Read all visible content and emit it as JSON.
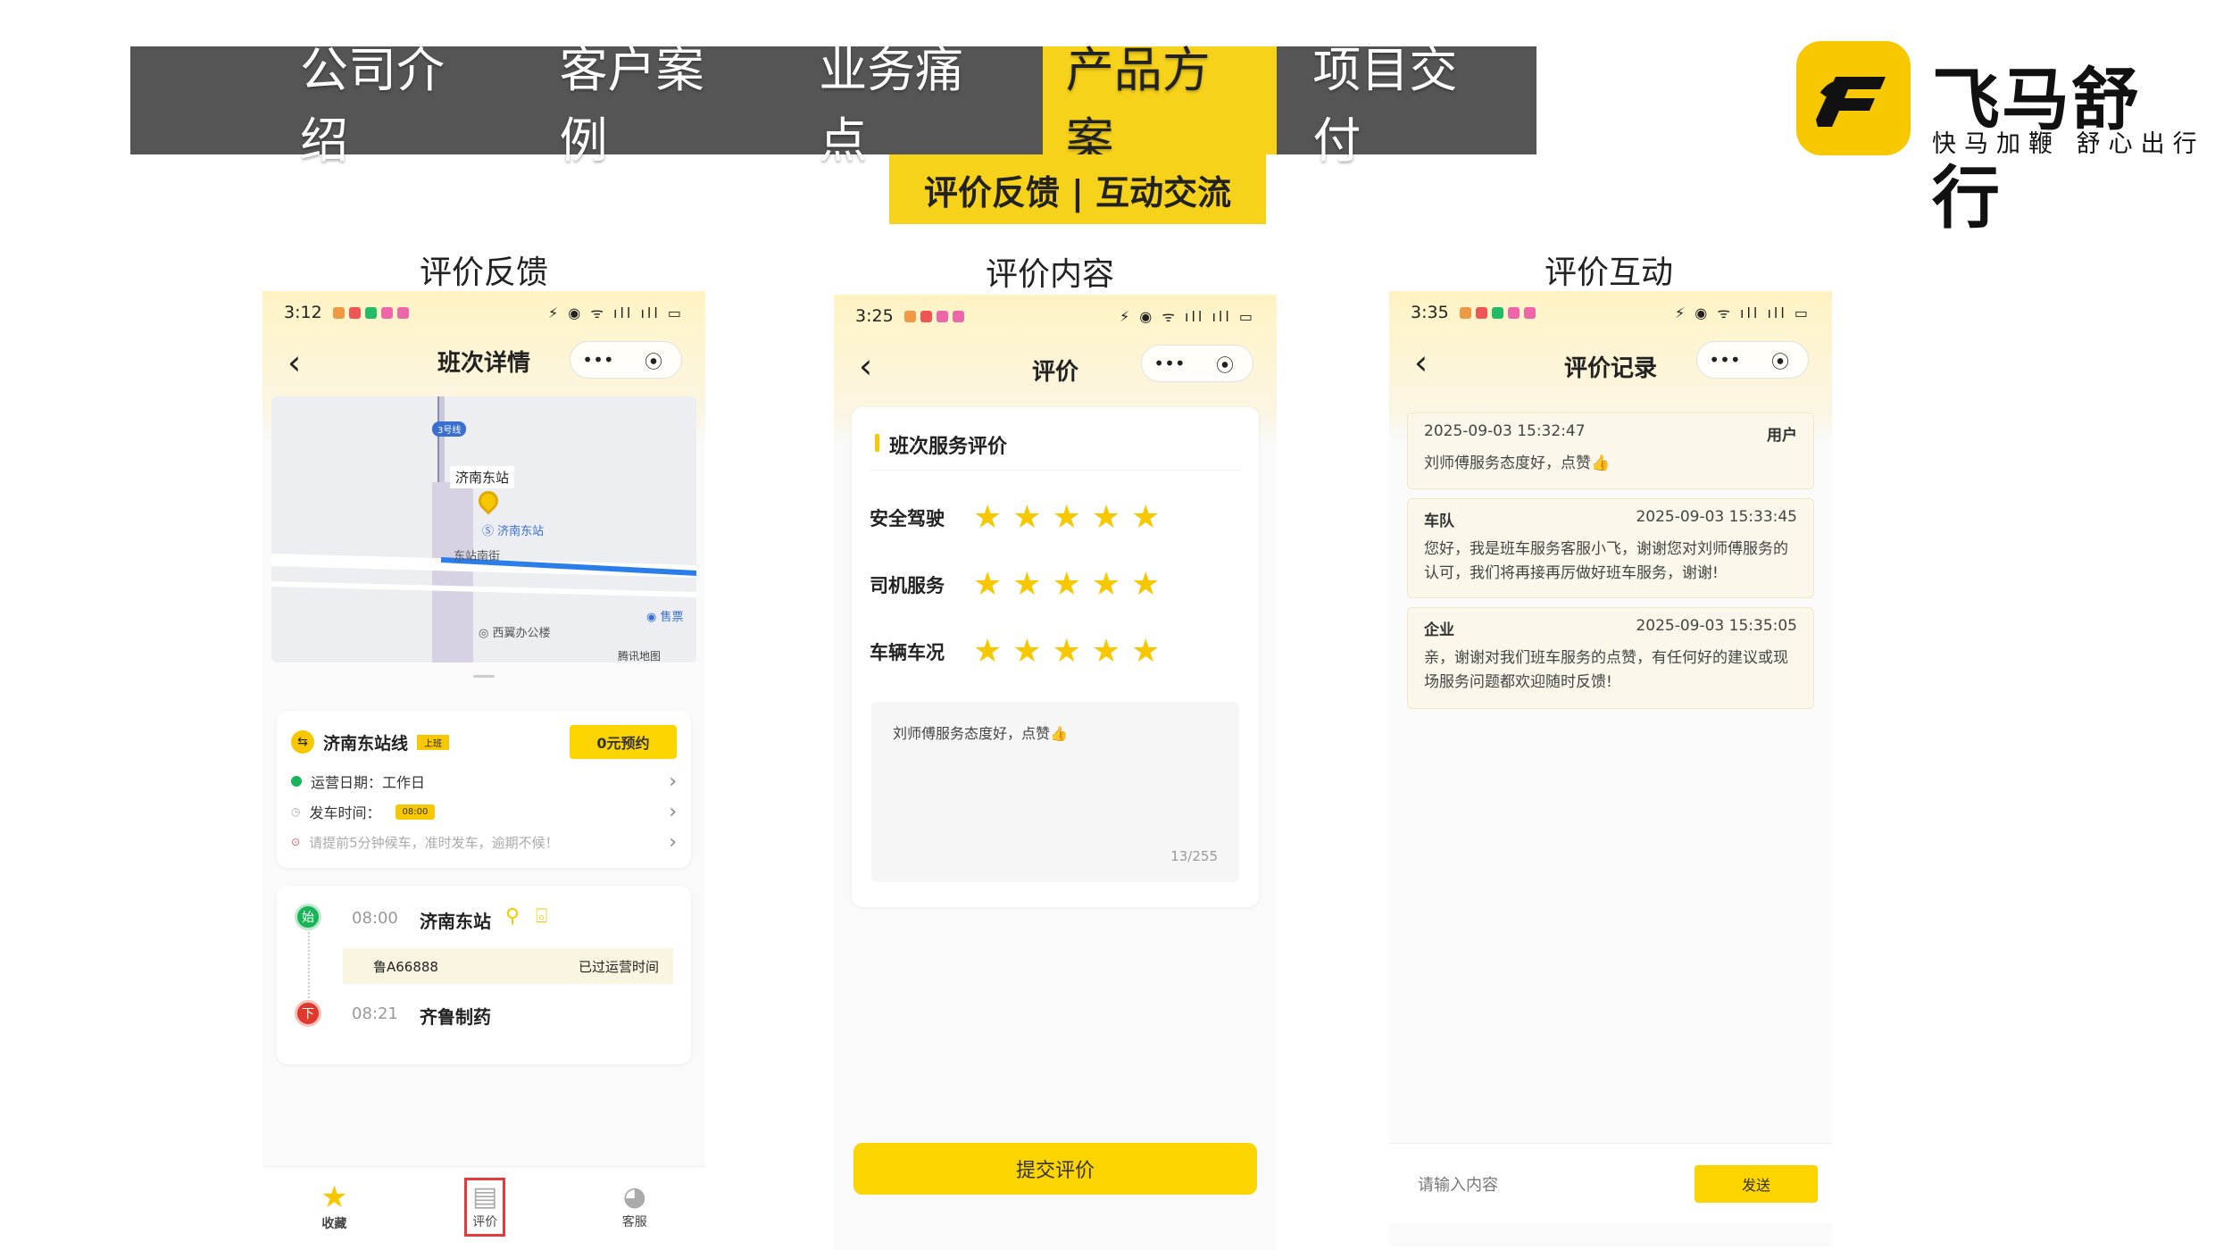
{
  "nav": {
    "tabs": [
      "公司介绍",
      "客户案例",
      "业务痛点",
      "产品方案",
      "项目交付"
    ],
    "active": 3,
    "subtab": "评价反馈 | 互动交流"
  },
  "logo": {
    "name": "飞马舒行",
    "slogan": "快马加鞭  舒心出行"
  },
  "colors": {
    "accent": "#f7d21a",
    "nav_bg": "#555555",
    "star": "#f7c800",
    "start_green": "#19b35a",
    "end_red": "#e0382c"
  },
  "phone1": {
    "caption": "评价反馈",
    "status_time": "3:12",
    "title": "班次详情",
    "map": {
      "line_badge": "3号线",
      "station_label": "济南东站",
      "poi_station": "济南东站",
      "street": "东站南街",
      "poi_office": "西翼办公楼",
      "poi_ticket": "售票",
      "map_brand": "腾讯地图"
    },
    "route_name": "济南东站线",
    "route_tag": "上班",
    "reserve_button": "0元预约",
    "operating_date": "运营日期：工作日",
    "depart_label": "发车时间：",
    "depart_time": "08:00",
    "notice": "请提前5分钟候车，准时发车，逾期不候！",
    "start_badge": "始",
    "start_time": "08:00",
    "start_station": "济南东站",
    "plate": "鲁A66888",
    "plate_status": "已过运营时间",
    "end_badge": "下",
    "end_time": "08:21",
    "end_station": "齐鲁制药",
    "tabs": [
      "收藏",
      "评价",
      "客服"
    ]
  },
  "phone2": {
    "caption": "评价内容",
    "status_time": "3:25",
    "title": "评价",
    "section": "班次服务评价",
    "ratings": [
      {
        "label": "安全驾驶",
        "stars": 5
      },
      {
        "label": "司机服务",
        "stars": 5
      },
      {
        "label": "车辆车况",
        "stars": 5
      }
    ],
    "comment": "刘师傅服务态度好，点赞👍",
    "counter": "13/255",
    "submit": "提交评价"
  },
  "phone3": {
    "caption": "评价互动",
    "status_time": "3:35",
    "title": "评价记录",
    "messages": [
      {
        "who": "用户",
        "time": "2025-09-03 15:32:47",
        "text": "刘师傅服务态度好，点赞👍"
      },
      {
        "who": "车队",
        "time": "2025-09-03 15:33:45",
        "text": "您好，我是班车服务客服小飞，谢谢您对刘师傅服务的认可，我们将再接再厉做好班车服务，谢谢!"
      },
      {
        "who": "企业",
        "time": "2025-09-03 15:35:05",
        "text": "亲，谢谢对我们班车服务的点赞，有任何好的建议或现场服务问题都欢迎随时反馈!"
      }
    ],
    "input_placeholder": "请输入内容",
    "send": "发送"
  },
  "capsule": {
    "more": "•••",
    "close": "⦿"
  }
}
